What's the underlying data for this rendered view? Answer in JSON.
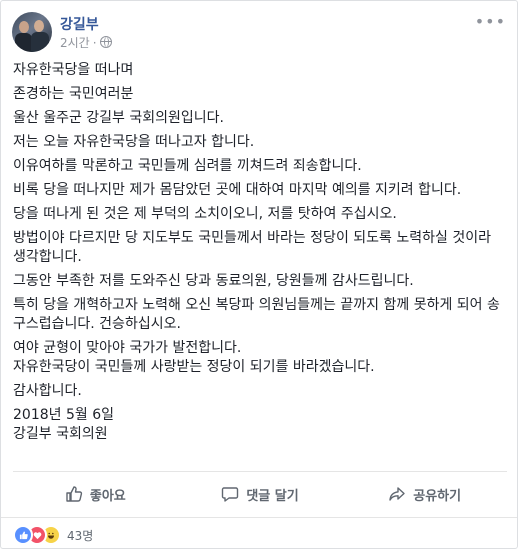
{
  "post": {
    "author": "강길부",
    "time": "2시간",
    "separator": "·",
    "menu_icon": "•••",
    "paragraphs": [
      "자유한국당을 떠나며",
      "존경하는 국민여러분",
      "울산 울주군 강길부 국회의원입니다.",
      "저는 오늘 자유한국당을 떠나고자 합니다.",
      "이유여하를 막론하고 국민들께 심려를 끼쳐드려 죄송합니다.",
      "비록 당을 떠나지만 제가 몸담았던 곳에 대하여 마지막 예의를 지키려 합니다.",
      "당을 떠나게 된 것은 제 부덕의 소치이오니, 저를 탓하여 주십시오.",
      "방법이야 다르지만 당 지도부도 국민들께서 바라는 정당이 되도록 노력하실 것이라 생각합니다.",
      "그동안 부족한 저를 도와주신 당과 동료의원, 당원들께 감사드립니다.",
      "특히 당을 개혁하고자 노력해 오신 복당파 의원님들께는 끝까지 함께 못하게 되어 송구스럽습니다. 건승하십시오.",
      "여야 균형이 맞아야 국가가 발전합니다.",
      "자유한국당이 국민들께 사랑받는 정당이 되기를 바라겠습니다.",
      "감사합니다.",
      "2018년 5월 6일",
      "강길부 국회의원"
    ]
  },
  "actions": {
    "like": "좋아요",
    "comment": "댓글 달기",
    "share": "공유하기"
  },
  "reactions": {
    "types": [
      "like",
      "love",
      "haha"
    ],
    "count": "43명"
  },
  "icons": {
    "avatar": "profile-photo",
    "privacy": "globe-icon",
    "like": "thumbs-up-icon",
    "comment": "comment-bubble-icon",
    "share": "share-arrow-icon"
  }
}
